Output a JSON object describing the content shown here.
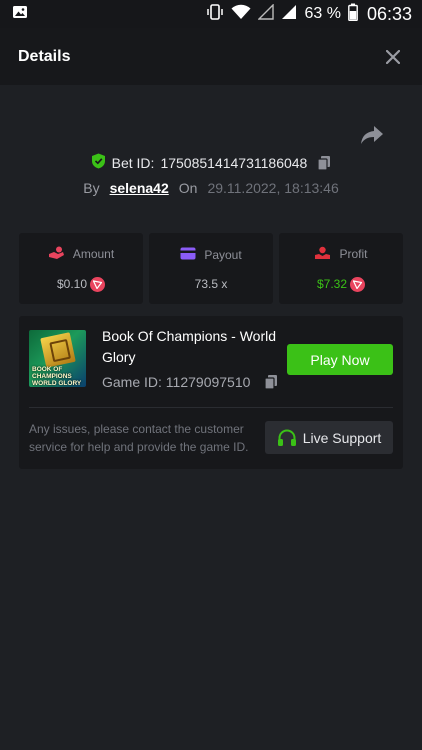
{
  "status_bar": {
    "battery_percent": "63 %",
    "time": "06:33",
    "icons": [
      "image-icon",
      "vibrate-icon",
      "wifi-icon",
      "signal-empty-icon",
      "signal-icon",
      "battery-icon"
    ]
  },
  "header": {
    "title": "Details",
    "close_icon": "close-icon"
  },
  "bet": {
    "id_label": "Bet ID:",
    "id_value": "1750851414731186048",
    "by_label": "By",
    "username": "selena42",
    "on_label": "On",
    "datetime": "29.11.2022, 18:13:46"
  },
  "stats": {
    "amount": {
      "label": "Amount",
      "value": "$0.10"
    },
    "payout": {
      "label": "Payout",
      "value": "73.5 x"
    },
    "profit": {
      "label": "Profit",
      "value": "$7.32"
    }
  },
  "game": {
    "title": "Book Of Champions - World Glory",
    "thumb_text_line1": "BOOK OF",
    "thumb_text_line2": "CHAMPIONS",
    "thumb_text_line3": "WORLD GLORY",
    "id_label": "Game ID:",
    "id_value": "11279097510",
    "play_label": "Play Now",
    "issue_text": "Any issues, please contact the customer service for help and provide the game ID.",
    "support_label": "Live Support"
  },
  "colors": {
    "accent_green": "#3bc117",
    "coin_red": "#e9445e",
    "amount_icon": "#e9445e",
    "payout_icon": "#8b5cf6",
    "profit_icon": "#e0313c"
  }
}
